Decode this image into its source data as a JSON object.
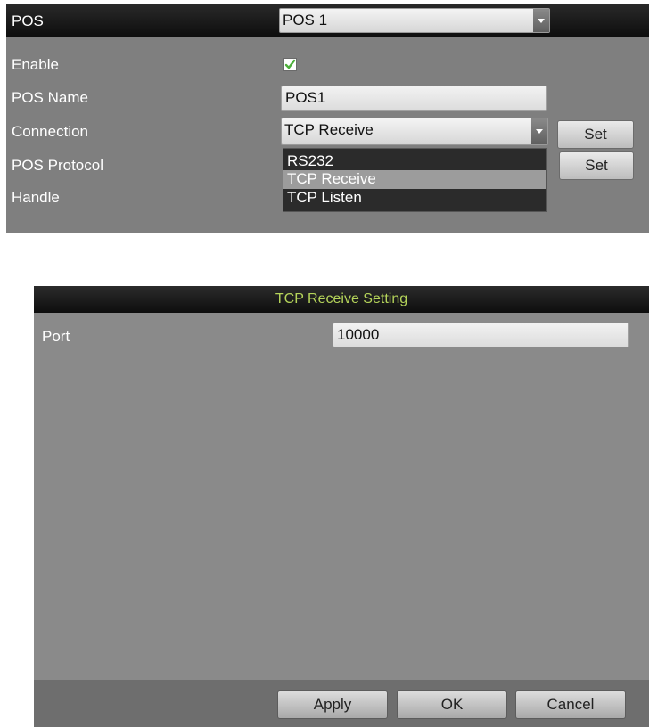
{
  "pos_panel": {
    "pos_label": "POS",
    "pos_select_value": "POS 1",
    "enable_label": "Enable",
    "enable_checked": true,
    "pos_name_label": "POS Name",
    "pos_name_value": "POS1",
    "connection_label": "Connection",
    "connection_value": "TCP Receive",
    "connection_set_label": "Set",
    "protocol_label": "POS Protocol",
    "protocol_set_label": "Set",
    "handle_label": "Handle",
    "connection_options": [
      "RS232",
      "TCP Receive",
      "TCP Listen"
    ],
    "selected_option": "TCP Receive"
  },
  "tcp_dialog": {
    "title": "TCP Receive Setting",
    "port_label": "Port",
    "port_value": "10000",
    "apply_label": "Apply",
    "ok_label": "OK",
    "cancel_label": "Cancel"
  },
  "colors": {
    "panel_bg": "#7f7f7f",
    "title_bar": "#1a1a1a",
    "dialog_title_text": "#b5d45a",
    "check_green": "#4caf3a"
  }
}
